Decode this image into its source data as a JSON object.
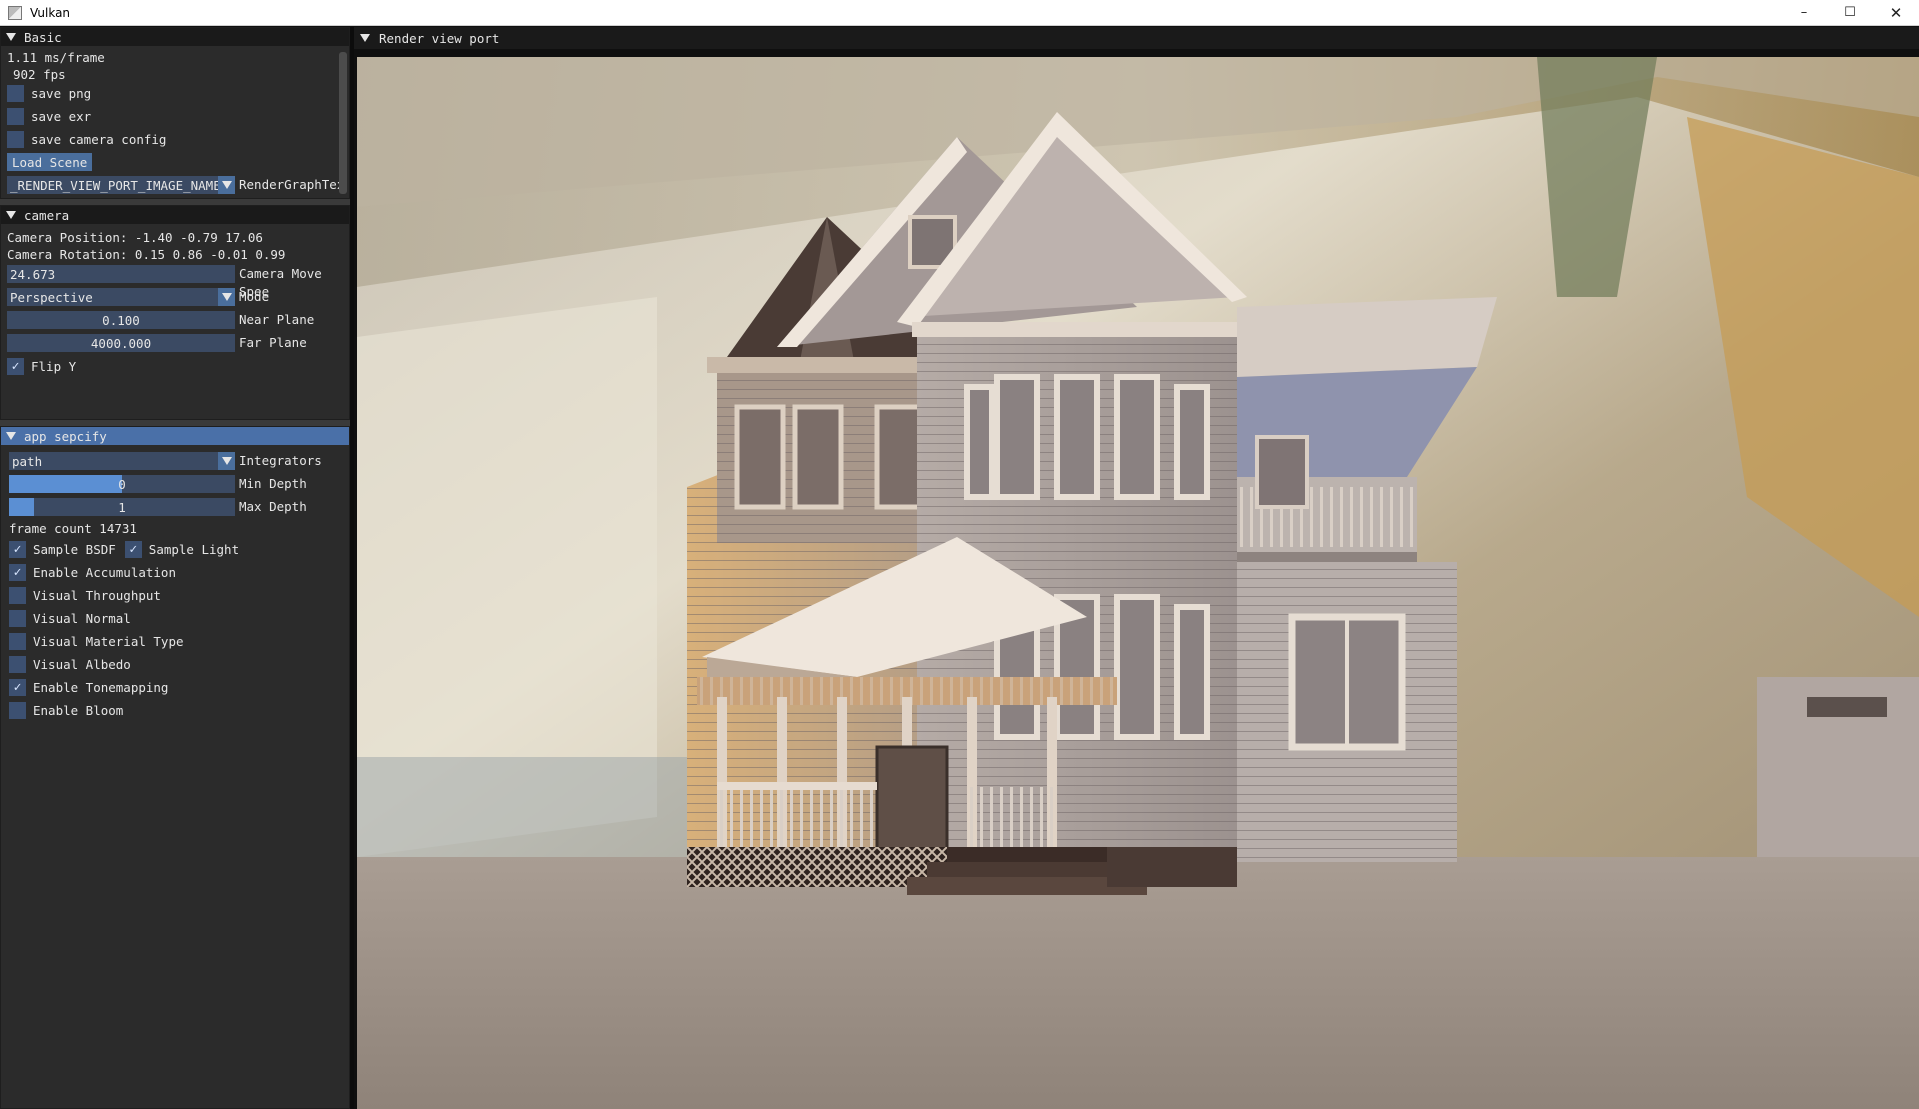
{
  "window": {
    "title": "Vulkan",
    "minimize": "–",
    "maximize": "☐",
    "close": "✕"
  },
  "basic": {
    "header": "Basic",
    "ms_frame": "1.11 ms/frame",
    "fps": "902 fps",
    "save_png": "save png",
    "save_exr": "save exr",
    "save_camera_config": "save camera config",
    "load_scene": "Load Scene",
    "image_combo": "_RENDER_VIEW_PORT_IMAGE_NAME_",
    "image_combo_label": "RenderGraphTex"
  },
  "camera": {
    "header": "camera",
    "position": "Camera Position: -1.40 -0.79 17.06",
    "rotation": "Camera Rotation: 0.15 0.86 -0.01 0.99",
    "move_speed_value": "24.673",
    "move_speed_label": "Camera Move Spee",
    "mode_value": "Perspective",
    "mode_label": "Mode",
    "near_value": "0.100",
    "near_label": "Near Plane",
    "far_value": "4000.000",
    "far_label": "Far Plane",
    "flip_y": "Flip Y",
    "flip_y_checked": true
  },
  "app": {
    "header": "app sepcify",
    "integrator_value": "path",
    "integrator_label": "Integrators",
    "min_depth_value": "0",
    "min_depth_label": "Min Depth",
    "min_depth_fill": 0.5,
    "max_depth_value": "1",
    "max_depth_label": "Max Depth",
    "max_depth_fill": 0.11,
    "frame_count": "frame count 14731",
    "sample_bsdf": "Sample BSDF",
    "sample_light": "Sample Light",
    "enable_accumulation": "Enable Accumulation",
    "visual_throughput": "Visual Throughput",
    "visual_normal": "Visual Normal",
    "visual_material_type": "Visual Material Type",
    "visual_albedo": "Visual Albedo",
    "enable_tonemapping": "Enable Tonemapping",
    "enable_bloom": "Enable Bloom",
    "check_mark": "✓"
  },
  "viewport": {
    "header": "Render view port"
  }
}
